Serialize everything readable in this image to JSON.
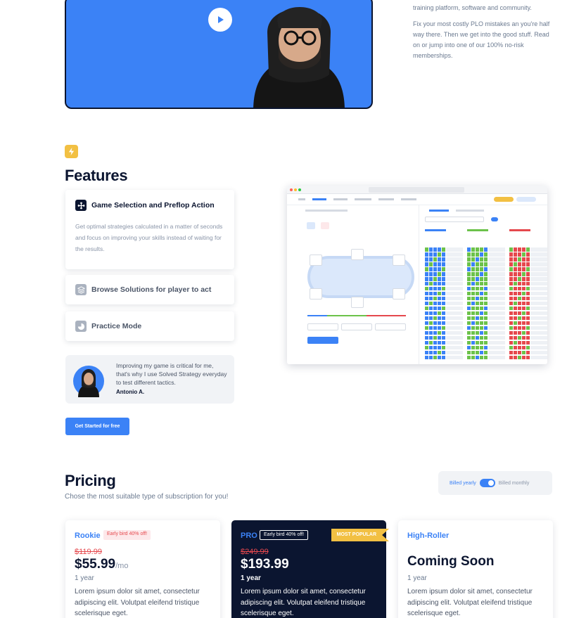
{
  "hero": {
    "paragraph_1": "training platform, software and community.",
    "paragraph_2": "Fix your most costly PLO mistakes an you're half way there. Then we get into the good stuff. Read on or jump into one of our 100% no-risk memberships."
  },
  "features": {
    "title": "Features",
    "items": [
      {
        "title": "Game Selection and Preflop Action",
        "description": "Get optimal strategies calculated in a matter of seconds and focus on improving your skills instead of waiting for the results.",
        "icon": "cross-arrows-icon"
      },
      {
        "title": "Browse Solutions for player to act",
        "icon": "layers-icon"
      },
      {
        "title": "Practice Mode",
        "icon": "pie-icon"
      }
    ],
    "testimonial": {
      "quote": "Improving my game is critical for me, that's why I use Solved Strategy everyday to test different tactics.",
      "author": "Antonio A."
    },
    "cta": "Get Started for free"
  },
  "pricing": {
    "title": "Pricing",
    "subtitle": "Chose the most suitable type of subscription for you!",
    "billing": {
      "yearly": "Billed yearly",
      "monthly": "Billed monthly",
      "selected": "yearly"
    },
    "plans": [
      {
        "name": "Rookie",
        "badge": "Early bird 40% off!",
        "old_price": "$119.99",
        "price": "$55.99",
        "per": "/mo",
        "term": "1 year",
        "description": "Lorem ipsum dolor sit amet, consectetur adipiscing elit. Volutpat eleifend tristique scelerisque eget."
      },
      {
        "name": "PRO",
        "badge": "Early bird 40% off!",
        "ribbon": "MOST POPULAR",
        "old_price": "$249.99",
        "price": "$193.99",
        "term": "1 year",
        "description": "Lorem ipsum dolor sit amet, consectetur adipiscing elit. Volutpat eleifend tristique scelerisque eget."
      },
      {
        "name": "High-Roller",
        "status": "Coming Soon",
        "term": "1 year",
        "description": "Lorem ipsum dolor sit amet, consectetur adipiscing elit. Volutpat eleifend tristique scelerisque eget."
      }
    ]
  },
  "colors": {
    "brand_blue": "#3b82f6",
    "navy": "#0b1530",
    "accent_yellow": "#f2c043",
    "sale_red": "#e5484d"
  }
}
